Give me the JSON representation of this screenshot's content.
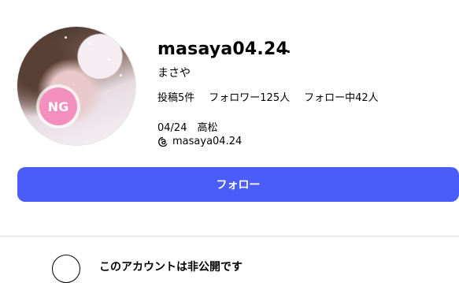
{
  "profile": {
    "username": "masaya04.24",
    "more_icon": "…",
    "full_name": "まさや",
    "stats": {
      "posts": "投稿5件",
      "followers": "フォロワー125人",
      "following": "フォロー中42人"
    },
    "bio": "04/24　高松",
    "threads_handle": "masaya04.24",
    "avatar_badge": "NG"
  },
  "actions": {
    "follow_label": "フォロー"
  },
  "private_notice": {
    "title": "このアカウントは非公開です"
  },
  "colors": {
    "follow_button": "#4a5df9",
    "avatar_badge": "#f38fbd"
  }
}
